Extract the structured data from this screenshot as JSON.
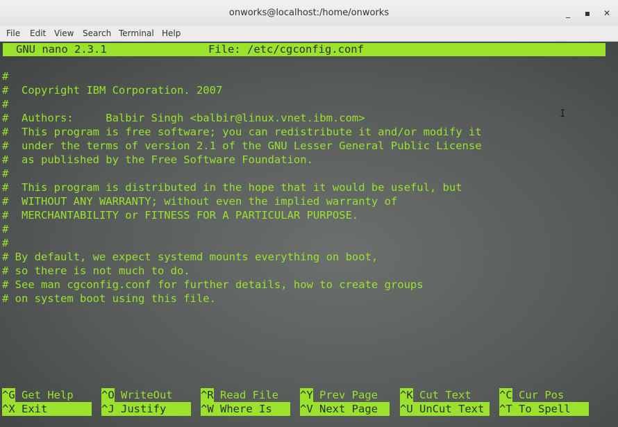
{
  "window": {
    "title": "onworks@localhost:/home/onworks",
    "minimize_label": "_",
    "maximize_label": "▪",
    "close_label": "✕"
  },
  "menubar": {
    "items": [
      "File",
      "Edit",
      "View",
      "Search",
      "Terminal",
      "Help"
    ]
  },
  "nano": {
    "version": "GNU nano 2.3.1",
    "file_label": "File: /etc/cgconfig.conf",
    "lines": [
      "#",
      "#  Copyright IBM Corporation. 2007",
      "#",
      "#  Authors:     Balbir Singh <balbir@linux.vnet.ibm.com>",
      "#  This program is free software; you can redistribute it and/or modify it",
      "#  under the terms of version 2.1 of the GNU Lesser General Public License",
      "#  as published by the Free Software Foundation.",
      "#",
      "#  This program is distributed in the hope that it would be useful, but",
      "#  WITHOUT ANY WARRANTY; without even the implied warranty of",
      "#  MERCHANTABILITY or FITNESS FOR A PARTICULAR PURPOSE.",
      "#",
      "#",
      "# By default, we expect systemd mounts everything on boot,",
      "# so there is not much to do.",
      "# See man cgconfig.conf for further details, how to create groups",
      "# on system boot using this file."
    ],
    "shortcuts_row1": [
      {
        "key": "^G",
        "label": " Get Help"
      },
      {
        "key": "^O",
        "label": " WriteOut"
      },
      {
        "key": "^R",
        "label": " Read File"
      },
      {
        "key": "^Y",
        "label": " Prev Page"
      },
      {
        "key": "^K",
        "label": " Cut Text"
      },
      {
        "key": "^C",
        "label": " Cur Pos"
      }
    ],
    "shortcuts_row2": [
      {
        "key": "^X",
        "label": " Exit"
      },
      {
        "key": "^J",
        "label": " Justify"
      },
      {
        "key": "^W",
        "label": " Where Is"
      },
      {
        "key": "^V",
        "label": " Next Page"
      },
      {
        "key": "^U",
        "label": " UnCut Text"
      },
      {
        "key": "^T",
        "label": " To Spell"
      }
    ]
  },
  "colors": {
    "terminal_text": "#9be22d",
    "terminal_bg": "#5a5f5d",
    "inverse_text": "#2b2f2d"
  }
}
